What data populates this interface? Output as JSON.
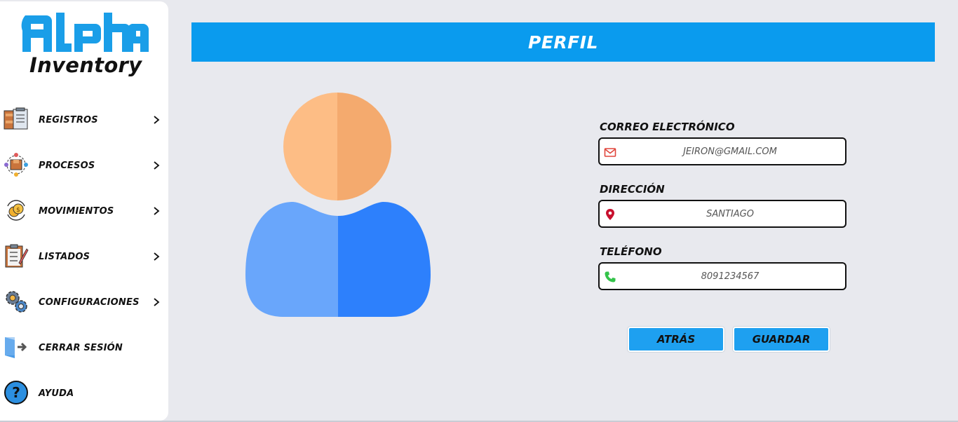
{
  "app": {
    "logo_text": "alpha",
    "logo_subtitle": "Inventory"
  },
  "sidebar": {
    "items": [
      {
        "label": "REGISTROS",
        "icon": "registros-icon",
        "has_submenu": true
      },
      {
        "label": "PROCESOS",
        "icon": "procesos-icon",
        "has_submenu": true
      },
      {
        "label": "MOVIMIENTOS",
        "icon": "movimientos-icon",
        "has_submenu": true
      },
      {
        "label": "LISTADOS",
        "icon": "listados-icon",
        "has_submenu": true
      },
      {
        "label": "CONFIGURACIONES",
        "icon": "gears-icon",
        "has_submenu": true
      },
      {
        "label": "CERRAR SESIÓN",
        "icon": "logout-door-icon",
        "has_submenu": false
      },
      {
        "label": "AYUDA",
        "icon": "help-icon",
        "has_submenu": false
      }
    ]
  },
  "header": {
    "title": "PERFIL"
  },
  "profile": {
    "email": {
      "label": "CORREO ELECTRÓNICO",
      "value": "JEIRON@GMAIL.COM",
      "icon": "envelope-icon"
    },
    "address": {
      "label": "DIRECCIÓN",
      "value": "SANTIAGO",
      "icon": "location-pin-icon"
    },
    "phone": {
      "label": "TELÉFONO",
      "value": "8091234567",
      "icon": "phone-icon"
    }
  },
  "actions": {
    "back_label": "ATRÁS",
    "save_label": "GUARDAR"
  },
  "colors": {
    "accent": "#0a9bee",
    "button": "#1ea0f0",
    "background": "#e8e9ee",
    "avatar_head_light": "#fdbd85",
    "avatar_head_dark": "#f4aa6e",
    "avatar_body_light": "#69a6fb",
    "avatar_body_dark": "#2d80fc"
  }
}
